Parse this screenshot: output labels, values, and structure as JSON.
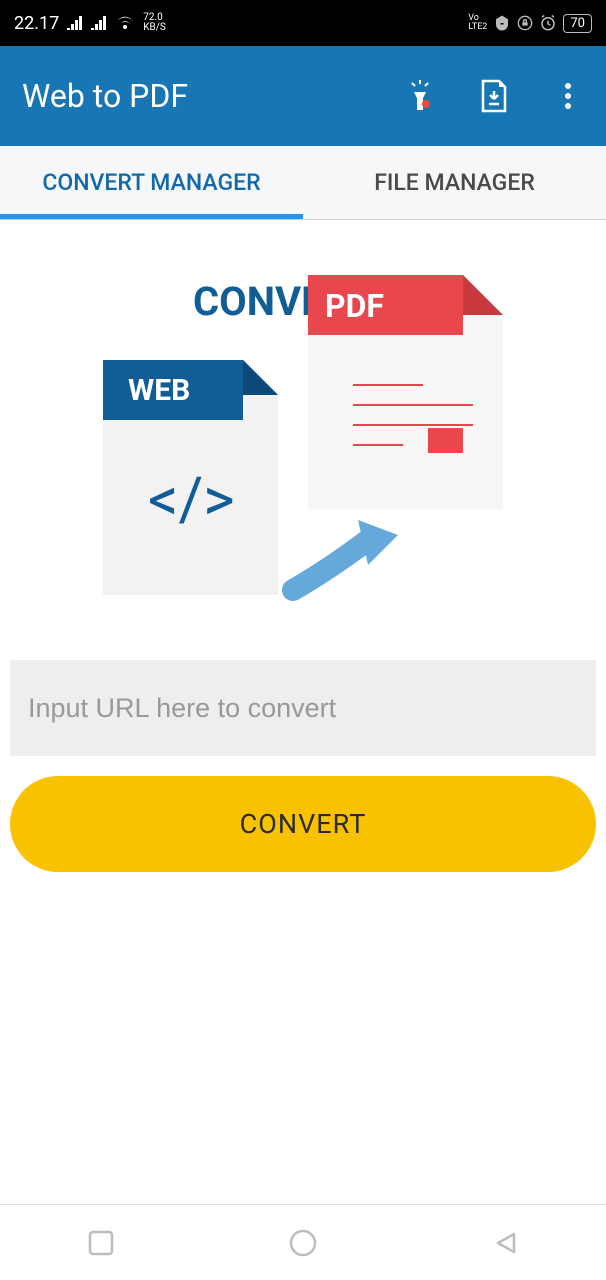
{
  "status": {
    "time": "22.17",
    "speed_top": "72.0",
    "speed_bottom": "KB/S",
    "lte_top": "Vo",
    "lte_bottom": "LTE2",
    "battery": "70"
  },
  "header": {
    "title": "Web to PDF"
  },
  "tabs": {
    "convert": "CONVERT MANAGER",
    "file": "FILE MANAGER"
  },
  "hero": {
    "convert_label": "CONVERT",
    "web_label": "WEB",
    "pdf_label": "PDF"
  },
  "input": {
    "placeholder": "Input URL here to convert",
    "value": ""
  },
  "button": {
    "convert": "CONVERT"
  }
}
